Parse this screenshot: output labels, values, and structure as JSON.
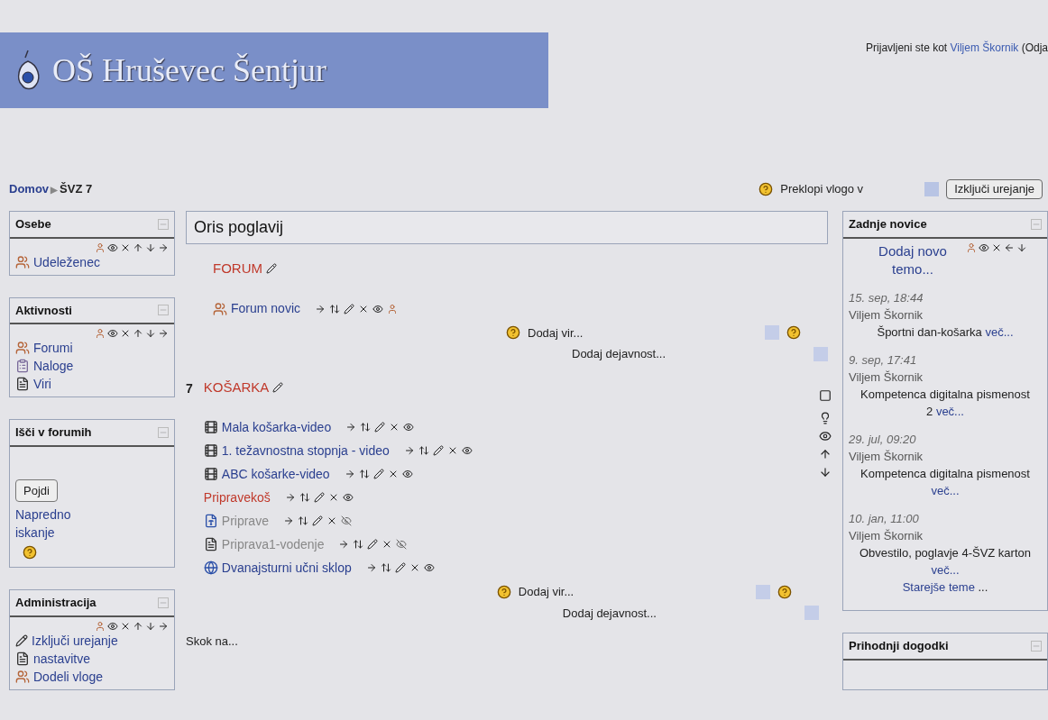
{
  "header": {
    "site_title": "OŠ Hruševec Šentjur",
    "login_prefix": "Prijavljeni ste kot",
    "login_user": "Viljem Škornik",
    "login_suffix": "(Odja"
  },
  "breadcrumb": {
    "home": "Domov",
    "separator": "▶",
    "current": "ŠVZ 7"
  },
  "role_switch": {
    "label": "Preklopi vlogo v",
    "button": "Izključi urejanje"
  },
  "left_blocks": [
    {
      "kind": "list",
      "title": "Osebe",
      "items": [
        {
          "kind": "people",
          "label": "Udeleženec"
        }
      ]
    },
    {
      "kind": "list",
      "title": "Aktivnosti",
      "items": [
        {
          "kind": "people",
          "label": "Forumi"
        },
        {
          "kind": "assignment",
          "label": "Naloge"
        },
        {
          "kind": "page",
          "label": "Viri"
        }
      ]
    },
    {
      "kind": "search",
      "title": "Išči v forumih",
      "button": "Pojdi",
      "link": "Napredno iskanje"
    },
    {
      "kind": "list",
      "title": "Administracija",
      "items": [
        {
          "kind": "edit",
          "label": "Izključi urejanje"
        },
        {
          "kind": "page",
          "label": "nastavitve"
        },
        {
          "kind": "people",
          "label": "Dodeli vloge"
        }
      ]
    }
  ],
  "main": {
    "title": "Oris poglavij",
    "sections": [
      {
        "name": "FORUM",
        "activities": [
          {
            "kind": "forum",
            "label": "Forum novic",
            "hidden": false
          }
        ],
        "add_resource": "Dodaj vir...",
        "add_activity": "Dodaj dejavnost..."
      },
      {
        "number": "7",
        "name": "KOŠARKA",
        "activities": [
          {
            "kind": "video",
            "label": "Mala košarka-video",
            "hidden": false
          },
          {
            "kind": "video",
            "label": "1. težavnostna stopnja - video",
            "hidden": false
          },
          {
            "kind": "video",
            "label": "ABC košarke-video",
            "hidden": false
          },
          {
            "kind": "label",
            "label": "Pripravekoš",
            "hidden": false
          },
          {
            "kind": "word",
            "label": "Priprave",
            "hidden": true
          },
          {
            "kind": "page",
            "label": "Priprava1-vodenje",
            "hidden": true
          },
          {
            "kind": "web",
            "label": "Dvanajsturni učni sklop",
            "hidden": false
          }
        ],
        "add_resource": "Dodaj vir...",
        "add_activity": "Dodaj dejavnost..."
      }
    ],
    "jump": "Skok na..."
  },
  "news": {
    "title": "Zadnje novice",
    "add": "Dodaj novo temo...",
    "posts": [
      {
        "date": "15. sep, 18:44",
        "author": "Viljem Škornik",
        "subject": "Športni dan-košarka",
        "more": "več..."
      },
      {
        "date": "9. sep, 17:41",
        "author": "Viljem Škornik",
        "subject": "Kompetenca digitalna pismenost 2",
        "more": "več..."
      },
      {
        "date": "29. jul, 09:20",
        "author": "Viljem Škornik",
        "subject": "Kompetenca digitalna pismenost",
        "more": "več..."
      },
      {
        "date": "10. jan, 11:00",
        "author": "Viljem Škornik",
        "subject": "Obvestilo, poglavje 4-ŠVZ karton",
        "more": "več..."
      }
    ],
    "older": "Starejše teme",
    "older_suffix": "..."
  },
  "events": {
    "title": "Prihodnji dogodki"
  }
}
